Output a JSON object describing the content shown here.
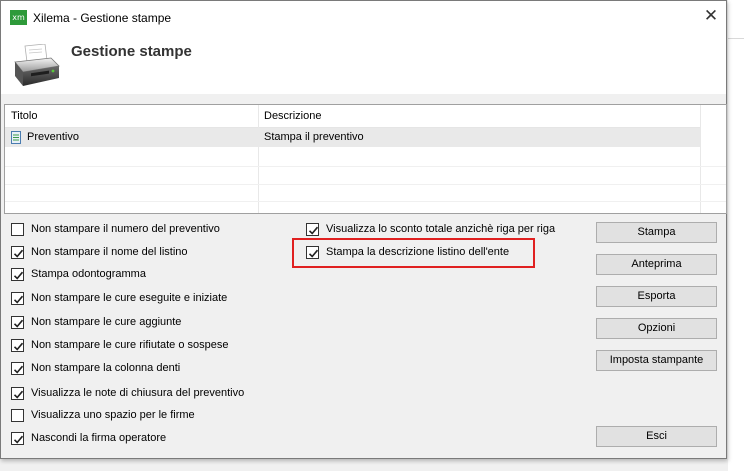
{
  "window": {
    "title": "Xilema - Gestione stampe",
    "app_icon": "xm",
    "close": "✕"
  },
  "header": {
    "title": "Gestione stampe",
    "icon": "printer-icon"
  },
  "list": {
    "columns": [
      "Titolo",
      "Descrizione"
    ],
    "rows": [
      {
        "title": "Preventivo",
        "description": "Stampa il preventivo",
        "icon": "document-icon"
      }
    ]
  },
  "options_left": [
    {
      "label": "Non stampare il numero del preventivo",
      "checked": false
    },
    {
      "label": "Non stampare il nome del listino",
      "checked": true
    },
    {
      "label": "Stampa odontogramma",
      "checked": true
    },
    {
      "label": "Non stampare le cure eseguite e iniziate",
      "checked": true
    },
    {
      "label": "Non stampare le cure aggiunte",
      "checked": true
    },
    {
      "label": "Non stampare le cure rifiutate o sospese",
      "checked": true
    },
    {
      "label": "Non stampare la colonna denti",
      "checked": true
    },
    {
      "label": "Visualizza le note di chiusura del preventivo",
      "checked": true
    },
    {
      "label": "Visualizza uno spazio per le firme",
      "checked": false
    },
    {
      "label": "Nascondi la firma operatore",
      "checked": true
    }
  ],
  "options_right": [
    {
      "label": "Visualizza lo sconto totale anzichè riga per riga",
      "checked": true
    },
    {
      "label": "Stampa la descrizione listino dell'ente",
      "checked": true
    }
  ],
  "buttons": {
    "stampa": "Stampa",
    "anteprima": "Anteprima",
    "esporta": "Esporta",
    "opzioni": "Opzioni",
    "imposta": "Imposta stampante",
    "esci": "Esci"
  },
  "colors": {
    "highlight": "#e02020",
    "app_icon": "#2e9a3a"
  }
}
